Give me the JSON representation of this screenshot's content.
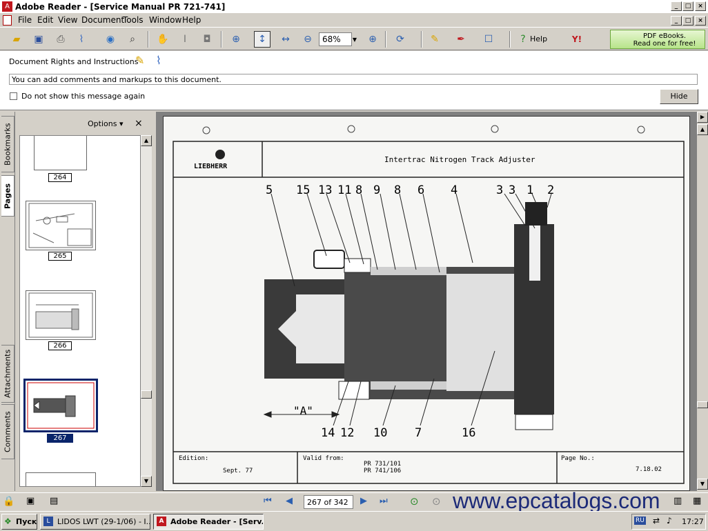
{
  "app": {
    "title": "Adobe Reader - [Service Manual PR 721-741]",
    "min": "_",
    "restore": "□",
    "close": "×"
  },
  "menu": {
    "items": [
      "File",
      "Edit",
      "View",
      "Document",
      "Tools",
      "Window",
      "Help"
    ]
  },
  "toolbar": {
    "zoom": "68%",
    "help_label": "Help",
    "promo_line1": "PDF eBooks.",
    "promo_line2": "Read one for free!",
    "icons": [
      "open-icon",
      "save-icon",
      "print-icon",
      "attach-icon",
      "email-icon",
      "search-icon",
      "hand-icon",
      "select-text-icon",
      "snapshot-icon",
      "zoom-in-icon",
      "fit-page-icon",
      "fit-width-icon",
      "zoom-out-minus-icon",
      "zoom-in-plus-icon",
      "rotate-icon",
      "comment-icon",
      "sign-icon",
      "forms-icon",
      "help-icon",
      "yahoo-icon"
    ]
  },
  "message": {
    "title": "Document Rights and Instructions",
    "text": "You can add comments and markups to this document.",
    "checkbox": "Do not show this message again",
    "hide": "Hide"
  },
  "sidebar": {
    "tabs": [
      "Bookmarks",
      "Pages",
      "Attachments",
      "Comments"
    ],
    "options": "Options",
    "close": "×",
    "pages": [
      "264",
      "265",
      "266",
      "267"
    ],
    "selected": "267"
  },
  "drawing": {
    "brand": "LIEBHERR",
    "title": "Intertrac Nitrogen Track Adjuster",
    "callouts_top": [
      "5",
      "15",
      "13",
      "11",
      "8",
      "9",
      "8",
      "6",
      "4",
      "3",
      "3",
      "1",
      "2"
    ],
    "callouts_bottom": [
      "14",
      "12",
      "10",
      "7",
      "16"
    ],
    "dimension": "\"A\"",
    "footer": {
      "edition_label": "Edition:",
      "edition": "Sept. 77",
      "valid_label": "Valid from:",
      "valid1": "PR 731/101",
      "valid2": "PR 741/106",
      "page_label": "Page No.:",
      "page": "7.18.02"
    }
  },
  "status": {
    "page_field": "267 of 342",
    "watermark": "www.epcatalogs.com"
  },
  "taskbar": {
    "start": "Пуск",
    "tasks": [
      "LIDOS LWT  (29-1/06) - I...",
      "Adobe Reader - [Serv..."
    ],
    "lang": "RU",
    "time": "17:27"
  }
}
